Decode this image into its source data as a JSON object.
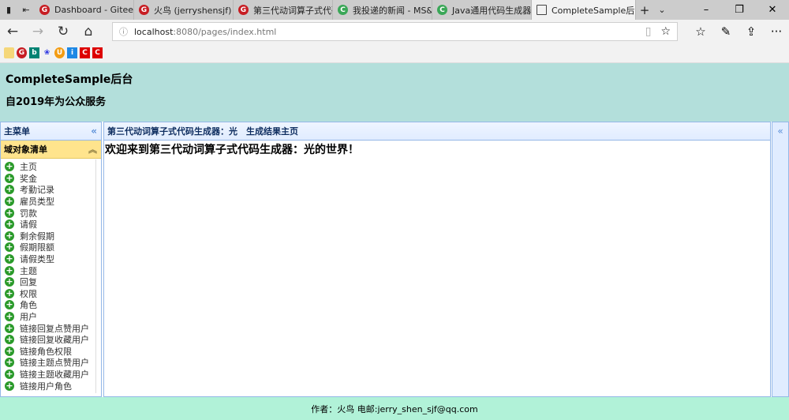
{
  "browser": {
    "tabs": [
      {
        "title": "Dashboard - Gitee",
        "icon": "gitee-icon",
        "color": "#c71d23"
      },
      {
        "title": "火鸟 (jerryshensjf) - Git",
        "icon": "gitee-icon",
        "color": "#c71d23"
      },
      {
        "title": "第三代动词算子式代码",
        "icon": "gitee-icon",
        "color": "#c71d23"
      },
      {
        "title": "我投递的新闻 - MS&A(",
        "icon": "c-icon",
        "color": "#3aa757"
      },
      {
        "title": "Java通用代码生成器光",
        "icon": "c-icon",
        "color": "#3aa757"
      },
      {
        "title": "CompleteSample后",
        "icon": "page-icon",
        "color": "#444444"
      }
    ],
    "url_host": "localhost",
    "url_rest": ":8080/pages/index.html"
  },
  "header": {
    "title": "CompleteSample后台",
    "subtitle": "自2019年为公众服务"
  },
  "west": {
    "title": "主菜单",
    "accordion_title": "域对象清单",
    "items": [
      "主页",
      "奖金",
      "考勤记录",
      "雇员类型",
      "罚款",
      "请假",
      "剩余假期",
      "假期限额",
      "请假类型",
      "主题",
      "回复",
      "权限",
      "角色",
      "用户",
      "链接回复点赞用户",
      "链接回复收藏用户",
      "链接角色权限",
      "链接主题点赞用户",
      "链接主题收藏用户",
      "链接用户角色"
    ]
  },
  "center": {
    "title": "第三代动词算子式代码生成器：光　生成结果主页",
    "welcome": "欢迎来到第三代动词算子式代码生成器：光的世界！"
  },
  "footer": {
    "text": "作者：火鸟 电邮:jerry_shen_sjf@qq.com"
  }
}
